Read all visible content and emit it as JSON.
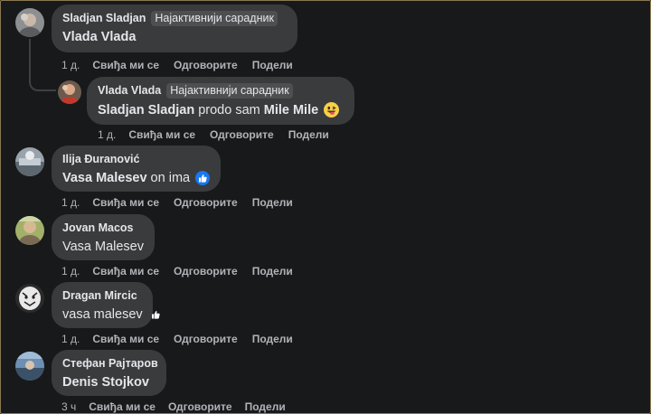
{
  "comments": [
    {
      "author": "Sladjan Sladjan",
      "badge": "Најактивнији сарадник",
      "text_bold": "Vlada Vlada",
      "time": "1 д.",
      "like": "Свиђа ми се",
      "reply": "Одговорите",
      "share": "Подели"
    },
    {
      "author": "Vlada Vlada",
      "badge": "Најактивнији сарадник",
      "mention1": "Sladjan Sladjan",
      "text_mid": " prodo sam ",
      "mention2": "Mile Mile",
      "emoji": "grinning-tongue-emoji",
      "time": "1 д.",
      "like": "Свиђа ми се",
      "reply": "Одговорите",
      "share": "Подели"
    },
    {
      "author": "Ilija Đuranović",
      "mention": "Vasa Malesev",
      "text_after": " on ima",
      "reaction": "like-reaction-icon",
      "time": "1 д.",
      "like": "Свиђа ми се",
      "reply": "Одговорите",
      "share": "Подели"
    },
    {
      "author": "Jovan Macos",
      "text": "Vasa Malesev",
      "time": "1 д.",
      "like": "Свиђа ми се",
      "reply": "Одговорите",
      "share": "Подели"
    },
    {
      "author": "Dragan Mircic",
      "text": "vasa malesev",
      "reaction": "like-reaction-icon",
      "time": "1 д.",
      "like": "Свиђа ми се",
      "reply": "Одговорите",
      "share": "Подели"
    },
    {
      "author": "Стефан Рајтаров",
      "text_bold": "Denis Stojkov",
      "time": "3 ч",
      "like": "Свиђа ми се",
      "reply": "Одговорите",
      "share": "Подели"
    }
  ],
  "colors": {
    "background": "#18191a",
    "bubble": "#3a3b3c",
    "badge": "#4e4f50",
    "text": "#e4e6eb",
    "muted": "#b0b3b8",
    "like_blue": "#1877f2"
  }
}
